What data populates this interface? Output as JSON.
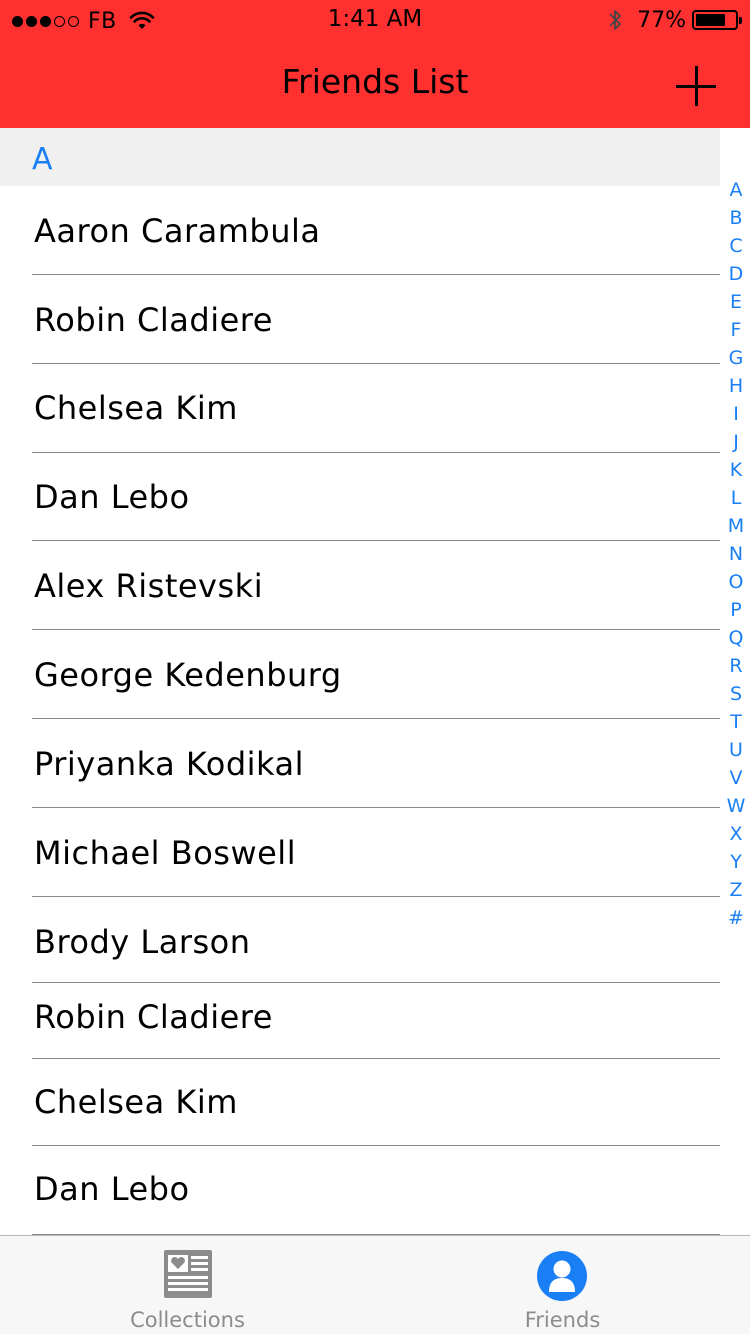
{
  "status_bar": {
    "signal_filled": 3,
    "signal_empty": 2,
    "carrier": "FB",
    "time": "1:41 AM",
    "battery_percent": "77%",
    "battery_level": 0.77,
    "icons": [
      "wifi-icon",
      "bluetooth-icon",
      "battery-icon"
    ]
  },
  "nav": {
    "title": "Friends List",
    "add_icon": "plus-icon"
  },
  "colors": {
    "header": "#ff3030",
    "accent": "#1a7ff5",
    "section_bg": "#f0f0f0",
    "separator": "#8a8a8a",
    "tab_inactive": "#8c8c8c"
  },
  "section": {
    "label": "A"
  },
  "friends": [
    "Aaron Carambula",
    "Robin Cladiere",
    "Chelsea Kim",
    "Dan Lebo",
    "Alex Ristevski",
    "George Kedenburg",
    "Priyanka Kodikal",
    "Michael Boswell",
    "Brody Larson",
    "Robin Cladiere",
    "Chelsea Kim",
    "Dan Lebo"
  ],
  "index_letters": [
    "A",
    "B",
    "C",
    "D",
    "E",
    "F",
    "G",
    "H",
    "I",
    "J",
    "K",
    "L",
    "M",
    "N",
    "O",
    "P",
    "Q",
    "R",
    "S",
    "T",
    "U",
    "V",
    "W",
    "X",
    "Y",
    "Z",
    "#"
  ],
  "tabbar": {
    "tabs": [
      {
        "label": "Collections",
        "icon": "collections-icon",
        "selected": false
      },
      {
        "label": "Friends",
        "icon": "friends-icon",
        "selected": true
      }
    ]
  }
}
